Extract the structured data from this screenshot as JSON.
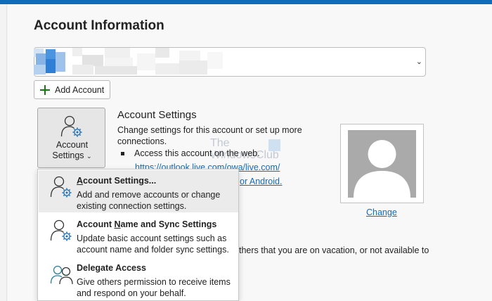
{
  "page": {
    "title": "Account Information"
  },
  "account_selector": {
    "chevron": "⌄"
  },
  "add_account": {
    "label": "Add Account",
    "icon": "plus-icon"
  },
  "account_settings_button": {
    "line1": "Account",
    "line2": "Settings",
    "caret": "⌄",
    "icon": "user-gear-icon"
  },
  "account_settings_section": {
    "title": "Account Settings",
    "description": "Change settings for this account or set up more connections.",
    "bullet": "Access this account on the web.",
    "web_link": "https://outlook.live.com/owa/live.com/",
    "android_link": "or Android."
  },
  "out_of_office": {
    "visible_text": "thers that you are on vacation, or not available to"
  },
  "watermark": {
    "line1": "The",
    "line2": "WindowsClub"
  },
  "profile_photo": {
    "change_label": "Change",
    "icon": "person-silhouette-icon"
  },
  "dropdown_menu": {
    "items": [
      {
        "title_before": "",
        "title_accel": "A",
        "title_after": "ccount Settings...",
        "description": "Add and remove accounts or change existing connection settings.",
        "icon": "user-gear-icon"
      },
      {
        "title_before": "Account ",
        "title_accel": "N",
        "title_after": "ame and Sync Settings",
        "description": "Update basic account settings such as account name and folder sync settings.",
        "icon": "user-gear-icon"
      },
      {
        "title_before": "Dele",
        "title_accel": "g",
        "title_after": "ate Access",
        "description": "Give others permission to receive items and respond on your behalf.",
        "icon": "delegate-users-icon"
      }
    ]
  },
  "colors": {
    "accent": "#0f6cbd",
    "add_green": "#107c10",
    "gear_blue": "#1f6fb5",
    "delegate_teal": "#2d7d9a"
  }
}
